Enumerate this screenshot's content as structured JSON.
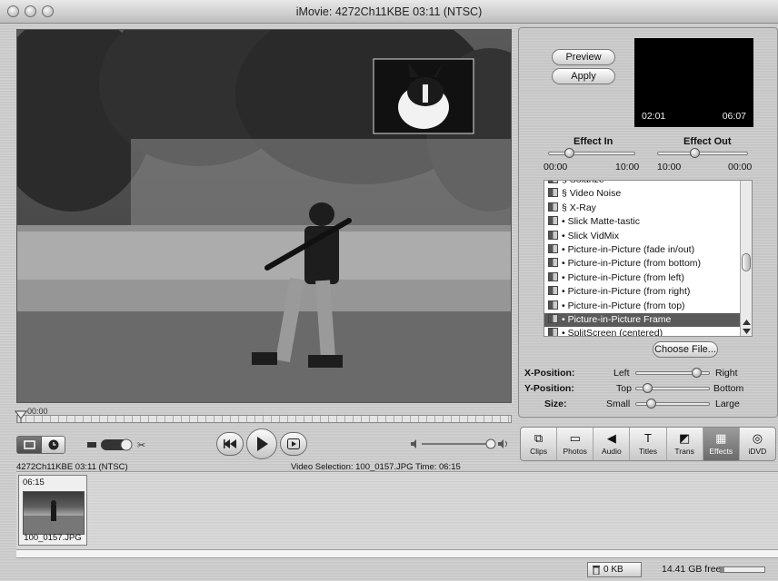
{
  "window": {
    "title": "iMovie: 4272Ch11KBE  03:11 (NTSC)"
  },
  "monitor": {
    "scrubber_time": "00:00"
  },
  "transport": {
    "rewind_icon": "rewind-icon",
    "play_icon": "play-icon",
    "fullscreen_play_icon": "fullscreen-play-icon"
  },
  "status": {
    "project_label": "4272Ch11KBE  03:11 (NTSC)",
    "selection_label": "Video Selection: 100_0157.JPG Time: 06:15"
  },
  "effects_panel": {
    "preview_label": "Preview",
    "apply_label": "Apply",
    "preview_time_left": "02:01",
    "preview_time_right": "06:07",
    "effect_in_label": "Effect In",
    "effect_out_label": "Effect Out",
    "effect_in_min": "00:00",
    "effect_in_max": "10:00",
    "effect_out_min": "10:00",
    "effect_out_max": "00:00",
    "items": [
      "§ Solarize",
      "§ Video Noise",
      "§ X-Ray",
      "• Slick Matte-tastic",
      "• Slick VidMix",
      "• Picture-in-Picture (fade in/out)",
      "• Picture-in-Picture (from bottom)",
      "• Picture-in-Picture (from left)",
      "• Picture-in-Picture (from right)",
      "• Picture-in-Picture (from top)",
      "• Picture-in-Picture Frame",
      "• SplitScreen (centered)"
    ],
    "selected_index": 10,
    "choose_file_label": "Choose File...",
    "x_position_label": "X-Position:",
    "y_position_label": "Y-Position:",
    "size_label": "Size:",
    "x_left": "Left",
    "x_right": "Right",
    "y_top": "Top",
    "y_bottom": "Bottom",
    "size_small": "Small",
    "size_large": "Large"
  },
  "tabs": [
    {
      "label": "Clips",
      "icon": "clips-icon",
      "glyph": "⧉"
    },
    {
      "label": "Photos",
      "icon": "photos-icon",
      "glyph": "▭"
    },
    {
      "label": "Audio",
      "icon": "audio-icon",
      "glyph": "◀"
    },
    {
      "label": "Titles",
      "icon": "titles-icon",
      "glyph": "T"
    },
    {
      "label": "Trans",
      "icon": "trans-icon",
      "glyph": "◩"
    },
    {
      "label": "Effects",
      "icon": "effects-icon",
      "glyph": "▦"
    },
    {
      "label": "iDVD",
      "icon": "idvd-icon",
      "glyph": "◎"
    }
  ],
  "active_tab": "Effects",
  "clip": {
    "duration": "06:15",
    "name": "100_0157.JPG"
  },
  "footer": {
    "trash_label": "0 KB",
    "free_space": "14.41 GB free"
  }
}
